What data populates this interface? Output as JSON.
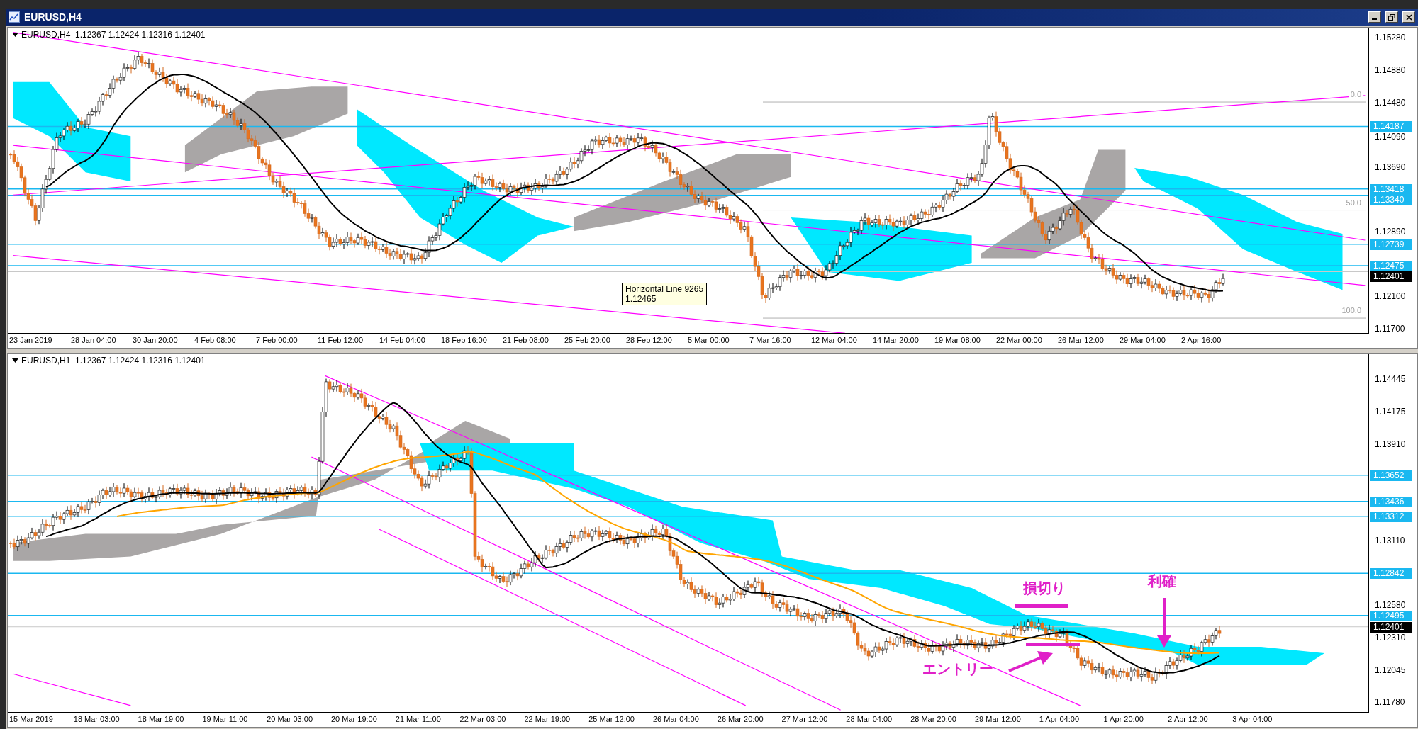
{
  "window": {
    "title": "EURUSD,H4"
  },
  "charts": [
    {
      "header": "EURUSD,H4  1.12367 1.12424 1.12316 1.12401",
      "price_ticks": [
        "1.15280",
        "1.14880",
        "1.14480",
        "1.14090",
        "1.13690",
        "1.12890",
        "1.12100",
        "1.11700"
      ],
      "price_tags": [
        {
          "label": "1.14187",
          "kind": "line"
        },
        {
          "label": "1.13418",
          "kind": "line"
        },
        {
          "label": "1.13340",
          "kind": "line"
        },
        {
          "label": "1.12739",
          "kind": "line"
        },
        {
          "label": "1.12475",
          "kind": "line"
        },
        {
          "label": "1.12401",
          "kind": "current"
        }
      ],
      "time_ticks": [
        "23 Jan 2019",
        "28 Jan 04:00",
        "30 Jan 20:00",
        "4 Feb 08:00",
        "7 Feb 00:00",
        "11 Feb 12:00",
        "14 Feb 04:00",
        "18 Feb 16:00",
        "21 Feb 08:00",
        "25 Feb 20:00",
        "28 Feb 12:00",
        "5 Mar 00:00",
        "7 Mar 16:00",
        "12 Mar 04:00",
        "14 Mar 20:00",
        "19 Mar 08:00",
        "22 Mar 00:00",
        "26 Mar 12:00",
        "29 Mar 04:00",
        "2 Apr 16:00"
      ],
      "fibo_levels": [
        "0.0",
        "50.0",
        "100.0"
      ],
      "tooltip": {
        "title": "Horizontal Line 9265",
        "value": "1.12465"
      }
    },
    {
      "header": "EURUSD,H1  1.12367 1.12424 1.12316 1.12401",
      "price_ticks": [
        "1.14445",
        "1.14175",
        "1.13910",
        "1.13110",
        "1.12580",
        "1.12310",
        "1.12045",
        "1.11780"
      ],
      "price_tags": [
        {
          "label": "1.13652",
          "kind": "line"
        },
        {
          "label": "1.13436",
          "kind": "line"
        },
        {
          "label": "1.13312",
          "kind": "line"
        },
        {
          "label": "1.12842",
          "kind": "line"
        },
        {
          "label": "1.12495",
          "kind": "line"
        },
        {
          "label": "1.12401",
          "kind": "current"
        }
      ],
      "time_ticks": [
        "15 Mar 2019",
        "18 Mar 03:00",
        "18 Mar 19:00",
        "19 Mar 11:00",
        "20 Mar 03:00",
        "20 Mar 19:00",
        "21 Mar 11:00",
        "22 Mar 03:00",
        "22 Mar 19:00",
        "25 Mar 12:00",
        "26 Mar 04:00",
        "26 Mar 20:00",
        "27 Mar 12:00",
        "28 Mar 04:00",
        "28 Mar 20:00",
        "29 Mar 12:00",
        "1 Apr 04:00",
        "1 Apr 20:00",
        "2 Apr 12:00",
        "3 Apr 04:00"
      ],
      "annotations": [
        {
          "kind": "stop",
          "text": "損切り"
        },
        {
          "kind": "take",
          "text": "利確"
        },
        {
          "kind": "entry",
          "text": "エントリー"
        }
      ]
    }
  ]
}
